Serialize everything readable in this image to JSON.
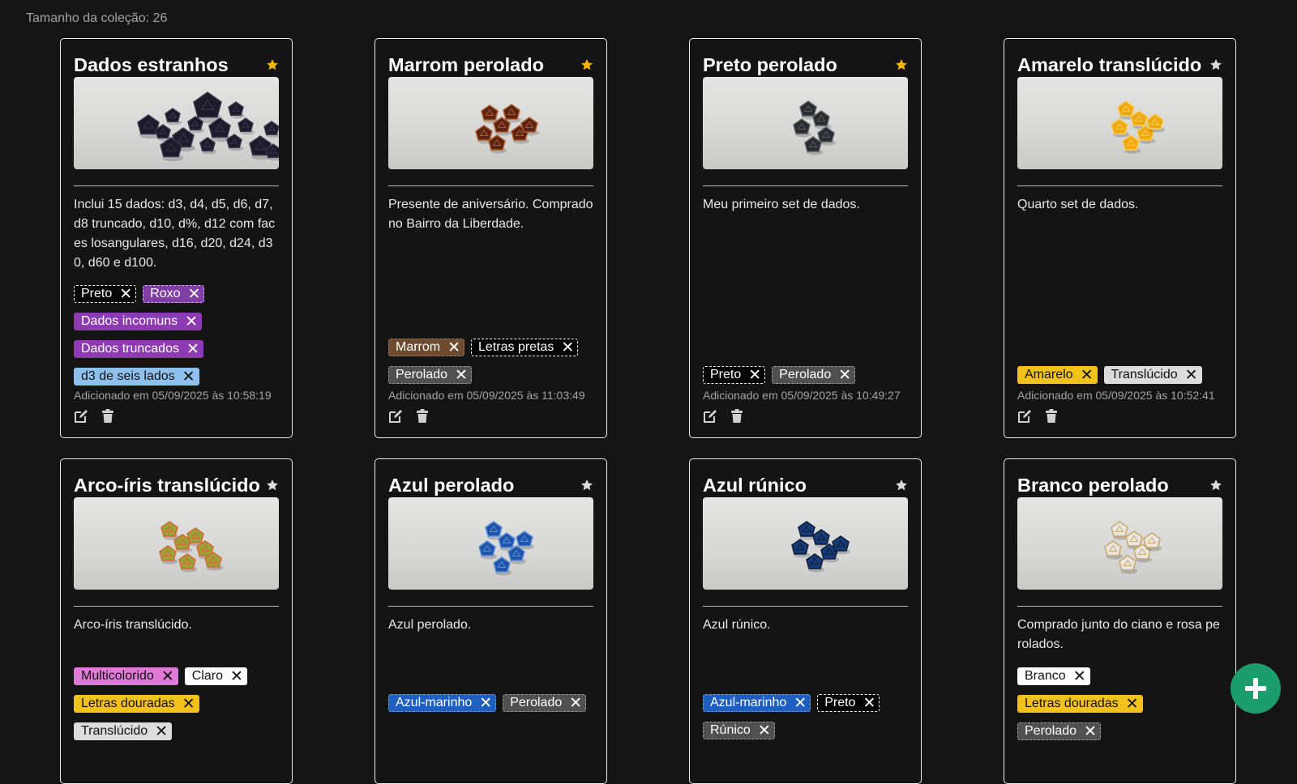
{
  "header": {
    "collection_size_label": "Tamanho da coleção: 26"
  },
  "colors": {
    "star_active": "#f6b400",
    "star_inactive": "#dcdcdc",
    "fab": "#1c9d6d",
    "background": "#151515"
  },
  "icons": [
    "star-icon",
    "edit-icon",
    "trash-icon",
    "close-icon",
    "plus-icon"
  ],
  "cards": [
    {
      "title": "Dados estranhos",
      "favorite": true,
      "description": "Inclui 15 dados: d3, d4, d5, d6, d7, d8 truncado, d10, d%, d12 com faces losangulares, d16, d20, d24, d30, d60 e d100.",
      "tags": [
        {
          "label": "Preto",
          "bg": "#000000",
          "fg": "#ffffff",
          "border": "#ffffff"
        },
        {
          "label": "Roxo",
          "bg": "#7f3fa5",
          "fg": "#ffffff",
          "border": "#d4b0e8"
        },
        {
          "label": "Dados incomuns",
          "bg": "#8e3bb3",
          "fg": "#ffffff",
          "border": "#8e3bb3"
        },
        {
          "label": "Dados truncados",
          "bg": "#8e3bb3",
          "fg": "#ffffff",
          "border": "#8e3bb3"
        },
        {
          "label": "d3 de seis lados",
          "bg": "#8ec0ee",
          "fg": "#111111",
          "border": "#8ec0ee"
        }
      ],
      "added": "Adicionado em 05/09/2025 às 10:58:19"
    },
    {
      "title": "Marrom perolado",
      "favorite": true,
      "description": "Presente de aniversário. Comprado no Bairro da Liberdade.",
      "tags": [
        {
          "label": "Marrom",
          "bg": "#6e4a2f",
          "fg": "#ffffff",
          "border": "#a07a58"
        },
        {
          "label": "Letras pretas",
          "bg": "#000000",
          "fg": "#ffffff",
          "border": "#ffffff"
        },
        {
          "label": "Perolado",
          "bg": "#505050",
          "fg": "#ffffff",
          "border": "#9a9a9a"
        }
      ],
      "added": "Adicionado em 05/09/2025 às 11:03:49"
    },
    {
      "title": "Preto perolado",
      "favorite": true,
      "description": "Meu primeiro set de dados.",
      "tags": [
        {
          "label": "Preto",
          "bg": "#000000",
          "fg": "#ffffff",
          "border": "#ffffff"
        },
        {
          "label": "Perolado",
          "bg": "#505050",
          "fg": "#ffffff",
          "border": "#9a9a9a"
        }
      ],
      "added": "Adicionado em 05/09/2025 às 10:49:27"
    },
    {
      "title": "Amarelo translúcido",
      "favorite": false,
      "description": "Quarto set de dados.",
      "tags": [
        {
          "label": "Amarelo",
          "bg": "#f3c21a",
          "fg": "#111111",
          "border": "#f3c21a"
        },
        {
          "label": "Translúcido",
          "bg": "#dcdcdc",
          "fg": "#111111",
          "border": "#dcdcdc"
        }
      ],
      "added": "Adicionado em 05/09/2025 às 10:52:41"
    },
    {
      "title": "Arco-íris translúcido",
      "favorite": false,
      "description": "Arco-íris translúcido.",
      "tags": [
        {
          "label": "Multicolorido",
          "bg": "#e07ad6",
          "fg": "#111111",
          "border": "#e07ad6"
        },
        {
          "label": "Claro",
          "bg": "#ffffff",
          "fg": "#111111",
          "border": "#ffffff"
        },
        {
          "label": "Letras douradas",
          "bg": "#f3c21a",
          "fg": "#111111",
          "border": "#f3c21a"
        },
        {
          "label": "Translúcido",
          "bg": "#dcdcdc",
          "fg": "#111111",
          "border": "#dcdcdc"
        }
      ]
    },
    {
      "title": "Azul perolado",
      "favorite": false,
      "description": "Azul perolado.",
      "tags": [
        {
          "label": "Azul-marinho",
          "bg": "#1f5fc0",
          "fg": "#ffffff",
          "border": "#6a9be0"
        },
        {
          "label": "Perolado",
          "bg": "#505050",
          "fg": "#ffffff",
          "border": "#9a9a9a"
        }
      ]
    },
    {
      "title": "Azul rúnico",
      "favorite": false,
      "description": "Azul rúnico.",
      "tags": [
        {
          "label": "Azul-marinho",
          "bg": "#1f5fc0",
          "fg": "#ffffff",
          "border": "#6a9be0"
        },
        {
          "label": "Preto",
          "bg": "#000000",
          "fg": "#ffffff",
          "border": "#ffffff"
        },
        {
          "label": "Rúnico",
          "bg": "#505050",
          "fg": "#ffffff",
          "border": "#9a9a9a"
        }
      ]
    },
    {
      "title": "Branco perolado",
      "favorite": false,
      "description": "Comprado junto do ciano e rosa perolados.",
      "tags": [
        {
          "label": "Branco",
          "bg": "#ffffff",
          "fg": "#111111",
          "border": "#ffffff"
        },
        {
          "label": "Letras douradas",
          "bg": "#f3c21a",
          "fg": "#111111",
          "border": "#f3c21a"
        },
        {
          "label": "Perolado",
          "bg": "#505050",
          "fg": "#ffffff",
          "border": "#9a9a9a"
        }
      ]
    }
  ]
}
